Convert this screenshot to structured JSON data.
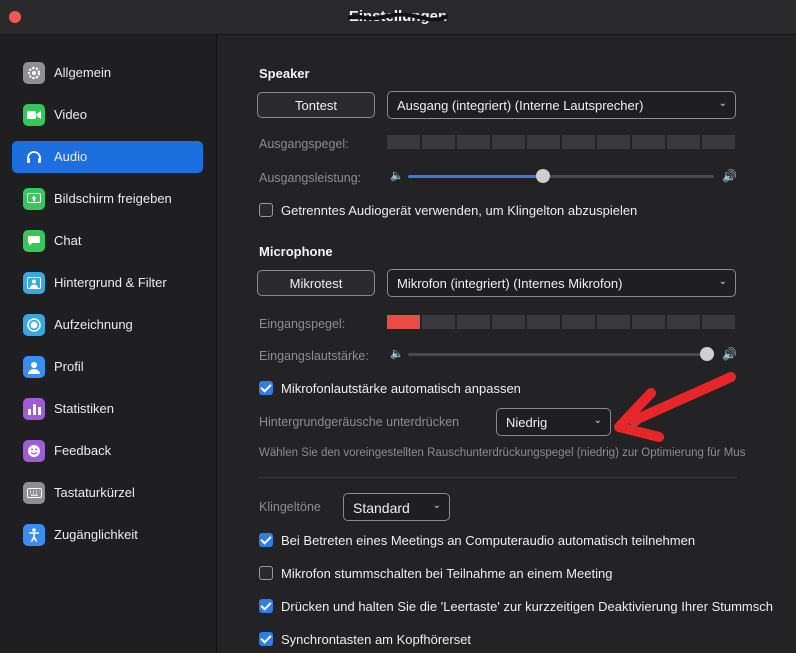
{
  "window": {
    "title": "Einstellungen"
  },
  "colors": {
    "accent": "#1d6fe0",
    "meter_active": "#ea4c44",
    "annotation_arrow": "#e8262a"
  },
  "sidebar": {
    "items": [
      {
        "label": "Allgemein",
        "icon": "gear-icon",
        "color": "#8e8e93"
      },
      {
        "label": "Video",
        "icon": "video-camera-icon",
        "color": "#34c759"
      },
      {
        "label": "Audio",
        "icon": "headphones-icon",
        "color": "#1d6fe0",
        "active": true
      },
      {
        "label": "Bildschirm freigeben",
        "icon": "share-screen-icon",
        "color": "#34c759"
      },
      {
        "label": "Chat",
        "icon": "chat-bubble-icon",
        "color": "#34c759"
      },
      {
        "label": "Hintergrund & Filter",
        "icon": "person-background-icon",
        "color": "#3aa7e0"
      },
      {
        "label": "Aufzeichnung",
        "icon": "record-icon",
        "color": "#3aa7e0"
      },
      {
        "label": "Profil",
        "icon": "person-icon",
        "color": "#3a8df0"
      },
      {
        "label": "Statistiken",
        "icon": "bar-chart-icon",
        "color": "#a05cd6"
      },
      {
        "label": "Feedback",
        "icon": "smiley-icon",
        "color": "#a05cd6"
      },
      {
        "label": "Tastaturkürzel",
        "icon": "keyboard-icon",
        "color": "#8e8e93"
      },
      {
        "label": "Zugänglichkeit",
        "icon": "accessibility-icon",
        "color": "#3a8df0"
      }
    ]
  },
  "speaker": {
    "title": "Speaker",
    "test_button": "Tontest",
    "device": "Ausgang (integriert) (Interne Lautsprecher)",
    "output_level_label": "Ausgangspegel:",
    "output_level": 0,
    "output_volume_label": "Ausgangsleistung:",
    "output_volume": 0.44,
    "separate_device_label": "Getrenntes Audiogerät verwenden, um Klingelton abzuspielen",
    "separate_device_checked": false
  },
  "microphone": {
    "title": "Microphone",
    "test_button": "Mikrotest",
    "device": "Mikrofon (integriert) (Internes Mikrofon)",
    "input_level_label": "Eingangspegel:",
    "input_level": 0.1,
    "input_volume_label": "Eingangslautstärke:",
    "input_volume": 1.0,
    "auto_adjust_label": "Mikrofonlautstärke automatisch anpassen",
    "auto_adjust_checked": true,
    "noise_label": "Hintergrundgeräusche unterdrücken",
    "noise_value": "Niedrig",
    "noise_desc": "Wählen Sie den voreingestellten Rauschunterdrückungspegel (niedrig) zur Optimierung für Mus"
  },
  "ringtone": {
    "label": "Klingeltöne",
    "value": "Standard"
  },
  "options": [
    {
      "label": "Bei Betreten eines Meetings an Computeraudio automatisch teilnehmen",
      "checked": true
    },
    {
      "label": "Mikrofon stummschalten bei Teilnahme an einem Meeting",
      "checked": false
    },
    {
      "label": "Drücken und halten Sie die 'Leertaste' zur kurzzeitigen Deaktivierung Ihrer Stummsch",
      "checked": true
    },
    {
      "label": "Synchrontasten am Kopfhörerset",
      "checked": true
    }
  ]
}
